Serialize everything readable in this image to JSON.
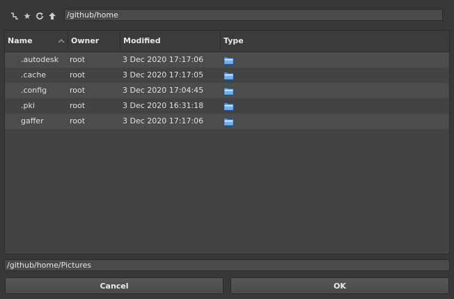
{
  "toolbar": {
    "icons": [
      "up-level-icon",
      "bookmark-star-icon",
      "refresh-icon",
      "home-arrow-icon"
    ],
    "path": "/github/home"
  },
  "file_list": {
    "columns": [
      "Name",
      "Owner",
      "Modified",
      "Type"
    ],
    "sort": {
      "column": "Name",
      "direction": "ascending"
    },
    "rows": [
      {
        "name": ".autodesk",
        "owner": "root",
        "modified": "3 Dec 2020 17:17:06",
        "type_icon": "folder-icon"
      },
      {
        "name": ".cache",
        "owner": "root",
        "modified": "3 Dec 2020 17:17:05",
        "type_icon": "folder-icon"
      },
      {
        "name": ".config",
        "owner": "root",
        "modified": "3 Dec 2020 17:04:45",
        "type_icon": "folder-icon"
      },
      {
        "name": ".pki",
        "owner": "root",
        "modified": "3 Dec 2020 16:31:18",
        "type_icon": "folder-icon"
      },
      {
        "name": "gaffer",
        "owner": "root",
        "modified": "3 Dec 2020 17:17:06",
        "type_icon": "folder-icon"
      }
    ]
  },
  "selection_path": "/github/home/Pictures",
  "buttons": {
    "cancel": "Cancel",
    "ok": "OK"
  },
  "colors": {
    "background": "#383838",
    "folder": "#4a8fd8"
  }
}
